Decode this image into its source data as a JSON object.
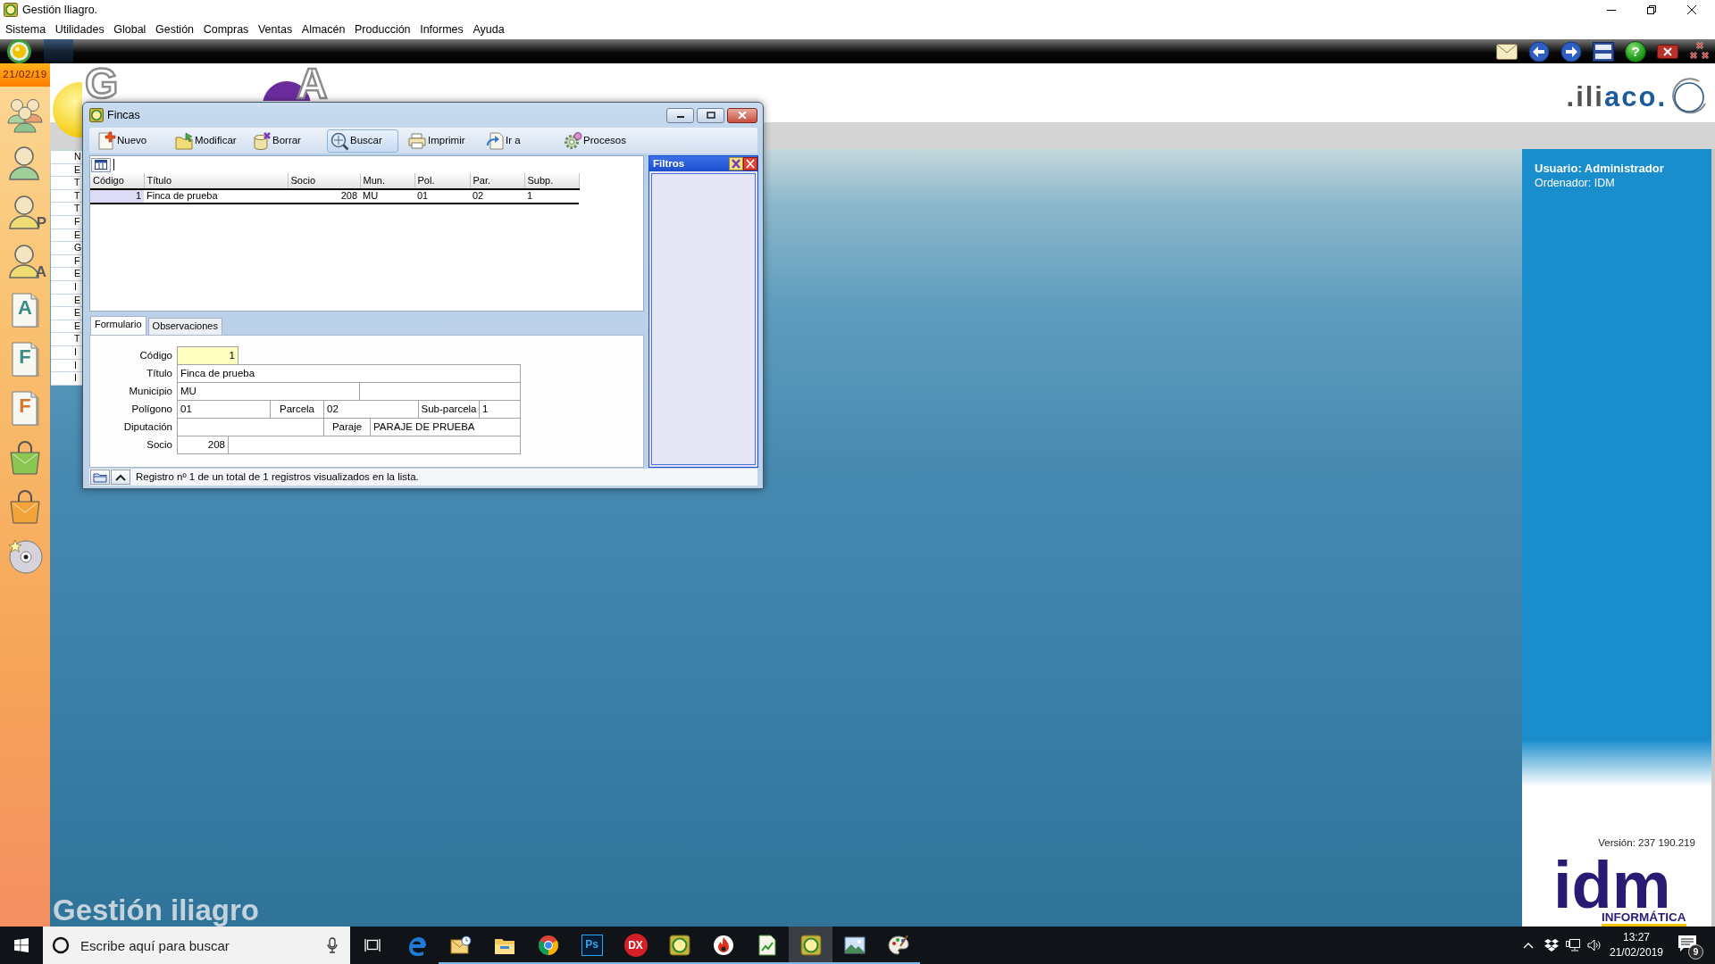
{
  "window": {
    "title": "Gestión Iliagro."
  },
  "menu": [
    "Sistema",
    "Utilidades",
    "Global",
    "Gestión",
    "Compras",
    "Ventas",
    "Almacén",
    "Producción",
    "Informes",
    "Ayuda"
  ],
  "app_toolbar": {
    "help_label": "?"
  },
  "sidebar": {
    "date": "21/02/19",
    "items": [
      {
        "kind": "group"
      },
      {
        "kind": "person",
        "color": "#9fcf98"
      },
      {
        "kind": "person",
        "letter": "P",
        "color": "#eedc72"
      },
      {
        "kind": "person",
        "letter": "A",
        "color": "#eedc72"
      },
      {
        "kind": "document",
        "letter": "A",
        "color": "#3d8c86"
      },
      {
        "kind": "document",
        "letter": "F",
        "color": "#3d8c86"
      },
      {
        "kind": "document",
        "letter": "F",
        "color": "#d8742a"
      },
      {
        "kind": "bag",
        "color": "#8cc652"
      },
      {
        "kind": "bag",
        "color": "#f2a43a"
      },
      {
        "kind": "disc"
      }
    ]
  },
  "banner": {
    "letters": [
      "G",
      "A"
    ],
    "logo": [
      ".ili",
      "aco."
    ]
  },
  "background_list": [
    "N",
    "E",
    "T",
    "T",
    "T",
    "F",
    "E",
    "G",
    "F",
    "E",
    "I",
    "E",
    "E",
    "E",
    "T",
    "I",
    "I",
    "I"
  ],
  "fincas": {
    "title": "Fincas",
    "toolbar": [
      {
        "label": "Nuevo",
        "kind": "new",
        "pressed": false
      },
      {
        "label": "Modificar",
        "kind": "edit",
        "pressed": false
      },
      {
        "label": "Borrar",
        "kind": "delete",
        "pressed": false
      },
      {
        "label": "Buscar",
        "kind": "search",
        "pressed": true
      },
      {
        "label": "Imprimir",
        "kind": "print",
        "pressed": false
      },
      {
        "label": "Ir a",
        "kind": "goto",
        "pressed": false
      },
      {
        "label": "Procesos",
        "kind": "process",
        "pressed": false
      }
    ],
    "list": {
      "columns": [
        {
          "label": "Código",
          "kind": "number"
        },
        {
          "label": "Título",
          "kind": "text"
        },
        {
          "label": "Socio",
          "kind": "number"
        },
        {
          "label": "Mun.",
          "kind": "text"
        },
        {
          "label": "Pol.",
          "kind": "text"
        },
        {
          "label": "Par.",
          "kind": "text"
        },
        {
          "label": "Subp.",
          "kind": "text"
        }
      ],
      "rows": [
        {
          "cells": [
            "1",
            "Finca de prueba",
            "208",
            "MU",
            "01",
            "02",
            "1"
          ],
          "selected": true
        }
      ]
    },
    "filters": {
      "title": "Filtros"
    },
    "tabs": [
      {
        "label": "Formulario",
        "selected": true
      },
      {
        "label": "Observaciones",
        "selected": false
      }
    ],
    "form": [
      {
        "label": "Código",
        "cells": [
          {
            "kind": "number",
            "value": "1",
            "focused": true
          }
        ]
      },
      {
        "label": "Título",
        "cells": [
          {
            "kind": "text",
            "value": "Finca de prueba",
            "focused": false
          }
        ]
      },
      {
        "label": "Municipio",
        "cells": [
          {
            "kind": "text",
            "value": "MU",
            "focused": false
          },
          {
            "kind": "text",
            "focused": false
          }
        ]
      },
      {
        "label": "Polígono",
        "cells": [
          {
            "kind": "text",
            "value": "01",
            "focused": false
          },
          {
            "kind": "label",
            "text": "Parcela"
          },
          {
            "kind": "text",
            "value": "02",
            "focused": false
          },
          {
            "kind": "label",
            "text": "Sub-parcela"
          },
          {
            "kind": "text",
            "value": "1",
            "focused": false
          }
        ]
      },
      {
        "label": "Diputación",
        "cells": [
          {
            "kind": "text",
            "focused": false
          },
          {
            "kind": "label",
            "text": "Paraje"
          },
          {
            "kind": "text",
            "value": "PARAJE DE PRUEBA",
            "focused": false
          }
        ]
      },
      {
        "label": "Socio",
        "cells": [
          {
            "kind": "number",
            "value": "208",
            "focused": false
          },
          {
            "kind": "text",
            "focused": false
          }
        ]
      }
    ],
    "status": "Registro nº 1 de un total de 1 registros visualizados en la lista."
  },
  "user_panel": {
    "user": "Usuario: Administrador",
    "computer": "Ordenador: IDM",
    "version": "Versión: 237 190.219",
    "logo": "idm",
    "logo_subtitle": "INFORMÁTICA"
  },
  "desktop_caption": "Gestión iliagro",
  "taskbar": {
    "search_placeholder": "Escribe aquí para buscar",
    "apps": [
      {
        "kind": "swirl",
        "running": false,
        "selected": false
      },
      {
        "kind": "mail",
        "running": true,
        "selected": false
      },
      {
        "kind": "folder",
        "running": true,
        "selected": false
      },
      {
        "kind": "ring",
        "running": true,
        "selected": false
      },
      {
        "kind": "tile",
        "text": "Ps",
        "running": true,
        "selected": false
      },
      {
        "kind": "badge",
        "text": "DX",
        "running": true,
        "selected": false
      },
      {
        "kind": "app",
        "running": true,
        "selected": false
      },
      {
        "kind": "flame",
        "running": true,
        "selected": false
      },
      {
        "kind": "sheet",
        "running": true,
        "selected": false
      },
      {
        "kind": "app",
        "running": true,
        "selected": true
      },
      {
        "kind": "picture",
        "running": true,
        "selected": false
      },
      {
        "kind": "palette",
        "running": true,
        "selected": false
      }
    ],
    "time": "13:27",
    "date": "21/02/2019",
    "notifications": "9"
  }
}
